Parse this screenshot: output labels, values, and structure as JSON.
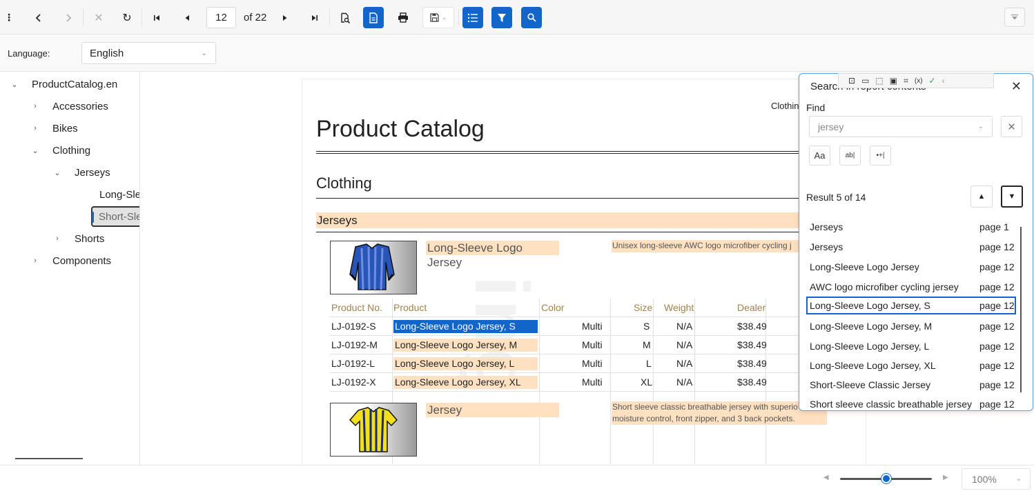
{
  "toolbar": {
    "menu_icon": "more-vertical-icon",
    "page_number": "12",
    "of_pages": "of 22",
    "save_icon": "save-icon"
  },
  "language": {
    "label": "Language:",
    "value": "English"
  },
  "tree": {
    "root": "ProductCatalog.en",
    "items": [
      {
        "label": "Accessories"
      },
      {
        "label": "Bikes"
      },
      {
        "label": "Clothing"
      },
      {
        "label": "Jerseys"
      },
      {
        "label": "Long-Sle"
      },
      {
        "label": "Short-Sle"
      },
      {
        "label": "Shorts"
      },
      {
        "label": "Components"
      }
    ]
  },
  "document": {
    "title": "Product Catalog",
    "header_right": "Clothin",
    "category": "Clothing",
    "subcategory": "Jerseys",
    "watermark": "ing",
    "products": [
      {
        "name": "Long-Sleeve Logo Jersey",
        "description": "Unisex long-sleeve AWC logo microfiber cycling j"
      },
      {
        "name": "Jersey",
        "description_line1": "Short sleeve classic breathable jersey with superio",
        "description_line2": "moisture control, front zipper, and 3 back pockets."
      }
    ],
    "table": {
      "headers": [
        "Product No.",
        "Product",
        "Color",
        "Size",
        "Weight",
        "Dealer"
      ],
      "rows": [
        {
          "no": "LJ-0192-S",
          "product": "Long-Sleeve Logo Jersey, S",
          "color": "Multi",
          "size": "S",
          "weight": "N/A",
          "dealer": "$38.49"
        },
        {
          "no": "LJ-0192-M",
          "product": "Long-Sleeve Logo Jersey, M",
          "color": "Multi",
          "size": "M",
          "weight": "N/A",
          "dealer": "$38.49"
        },
        {
          "no": "LJ-0192-L",
          "product": "Long-Sleeve Logo Jersey, L",
          "color": "Multi",
          "size": "L",
          "weight": "N/A",
          "dealer": "$38.49"
        },
        {
          "no": "LJ-0192-X",
          "product": "Long-Sleeve Logo Jersey, XL",
          "color": "Multi",
          "size": "XL",
          "weight": "N/A",
          "dealer": "$38.49"
        }
      ]
    }
  },
  "search": {
    "title": "Search in report contents",
    "find_label": "Find",
    "query": "jersey",
    "opt_case": "Aa",
    "opt_word": "ab|",
    "opt_regex": "•+|",
    "result_label": "Result 5 of 14",
    "results": [
      {
        "text": "Jerseys",
        "page": "page 1"
      },
      {
        "text": "Jerseys",
        "page": "page 12"
      },
      {
        "text": "Long-Sleeve Logo Jersey",
        "page": "page 12"
      },
      {
        "text": "AWC logo microfiber cycling jersey",
        "page": "page 12"
      },
      {
        "text": "Long-Sleeve Logo Jersey, S",
        "page": "page 12"
      },
      {
        "text": "Long-Sleeve Logo Jersey, M",
        "page": "page 12"
      },
      {
        "text": "Long-Sleeve Logo Jersey, L",
        "page": "page 12"
      },
      {
        "text": "Long-Sleeve Logo Jersey, XL",
        "page": "page 12"
      },
      {
        "text": "Short-Sleeve Classic Jersey",
        "page": "page 12"
      },
      {
        "text": "Short sleeve classic breathable jersey",
        "page": "page 12"
      }
    ]
  },
  "status": {
    "zoom": "100%",
    "zoom_level": 0.5
  },
  "colors": {
    "accent": "#1366c9",
    "highlight": "#fde1c1",
    "header_text": "#a0824a"
  }
}
